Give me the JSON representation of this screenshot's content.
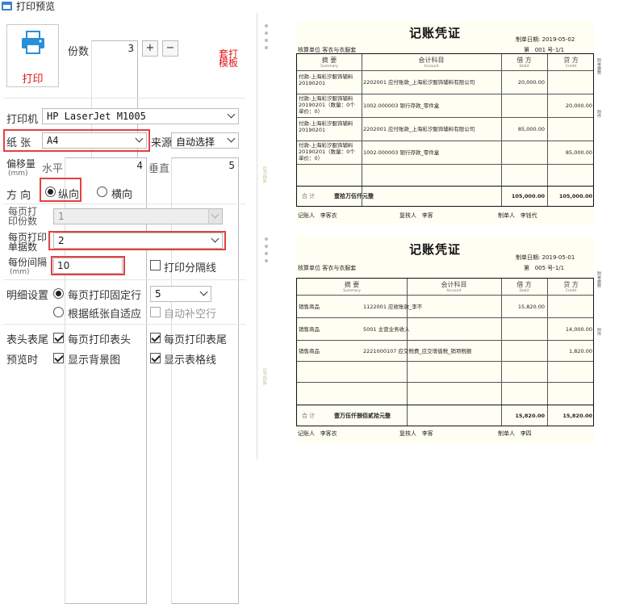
{
  "window": {
    "title": "打印预览"
  },
  "print_button": {
    "label": "打印"
  },
  "copies": {
    "label": "份数",
    "value": "3",
    "plus": "+",
    "minus": "−"
  },
  "template_link": "套打模板",
  "printer": {
    "label": "打印机",
    "value": "HP LaserJet M1005"
  },
  "paper": {
    "label": "纸  张",
    "value": "A4",
    "source_label": "来源",
    "source_value": "自动选择"
  },
  "offset": {
    "label": "偏移量",
    "unit": "(mm)",
    "horizontal_label": "水平",
    "horizontal_value": "4",
    "vertical_label": "垂直",
    "vertical_value": "5"
  },
  "orientation": {
    "label": "方  向",
    "portrait": "纵向",
    "landscape": "横向",
    "selected": "portrait"
  },
  "copies_per_page": {
    "label": "每页打印份数",
    "value": "1"
  },
  "docs_per_page": {
    "label": "每页打印单据数",
    "value": "2"
  },
  "copy_interval": {
    "label": "每份间隔",
    "unit": "(mm)",
    "value": "10",
    "print_separator": "打印分隔线"
  },
  "detail": {
    "label": "明细设置",
    "fixed_rows": "每页打印固定行",
    "fixed_rows_value": "5",
    "adaptive": "根据纸张自适应",
    "auto_fill": "自动补空行"
  },
  "header_footer": {
    "label": "表头表尾",
    "print_header": "每页打印表头",
    "print_footer": "每页打印表尾"
  },
  "preview": {
    "label": "预览时",
    "show_bg": "显示背景图",
    "show_grid": "显示表格线"
  },
  "vouchers": [
    {
      "title": "记账凭证",
      "date_label": "制单日期:",
      "date": "2019-05-02",
      "unit_label": "核算单位",
      "unit": "客衣与衣服套",
      "no_label": "第",
      "no": "001",
      "no_suffix": "号-1/1",
      "headers": {
        "summary": "摘 要",
        "summary_en": "Summary",
        "account": "会计科目",
        "account_en": "Account",
        "debit": "借 方",
        "debit_en": "Debit",
        "credit": "贷 方",
        "credit_en": "Credit"
      },
      "rows": [
        {
          "summary": "付款-上海彩汐服饰辅料 20190201",
          "account": "2202001 应付账款_上海彩汐服饰辅料有限公司",
          "debit": "20,000.00",
          "credit": ""
        },
        {
          "summary": "付款-上海彩汐服饰辅料 20190201（数量：0个 单价：0）",
          "account": "1002.000003 银行存款_零件盒",
          "debit": "",
          "credit": "20,000.00"
        },
        {
          "summary": "付款-上海彩汐服饰辅料 20190201",
          "account": "2202001 应付账款_上海彩汐服饰辅料有限公司",
          "debit": "85,000.00",
          "credit": ""
        },
        {
          "summary": "付款-上海彩汐服饰辅料 20190201（数量：0个 单价：0）",
          "account": "1002.000003 银行存款_零件盒",
          "debit": "",
          "credit": "85,000.00"
        }
      ],
      "total_label": "合 计",
      "total_words": "壹拾万伍仟元整",
      "total_debit": "105,000.00",
      "total_credit": "105,000.00",
      "bookkeeper_label": "记账人",
      "bookkeeper": "李客衣",
      "reviewer_label": "复核人",
      "reviewer": "李客",
      "preparer_label": "制单人",
      "preparer": "李钱代",
      "side_labels": [
        "附单据数",
        "附件"
      ]
    },
    {
      "title": "记账凭证",
      "date_label": "制单日期:",
      "date": "2019-05-01",
      "unit_label": "核算单位",
      "unit": "客衣与衣服套",
      "no_label": "第",
      "no": "005",
      "no_suffix": "号-1/1",
      "headers": {
        "summary": "摘 要",
        "summary_en": "Summary",
        "account": "会计科目",
        "account_en": "Account",
        "debit": "借 方",
        "debit_en": "Debit",
        "credit": "贷 方",
        "credit_en": "Credit"
      },
      "rows": [
        {
          "summary": "销售商品",
          "account": "1122001 应收账款_李不",
          "debit": "15,820.00",
          "credit": ""
        },
        {
          "summary": "销售商品",
          "account": "5001 主营业务收入",
          "debit": "",
          "credit": "14,000.00"
        },
        {
          "summary": "销售商品",
          "account": "2221000107 应交税费_应交增值税_销项税额",
          "debit": "",
          "credit": "1,820.00"
        },
        {
          "summary": "",
          "account": "",
          "debit": "",
          "credit": ""
        },
        {
          "summary": "",
          "account": "",
          "debit": "",
          "credit": ""
        }
      ],
      "total_label": "合 计",
      "total_words": "壹万伍仟捌佰贰拾元整",
      "total_debit": "15,820.00",
      "total_credit": "15,820.00",
      "bookkeeper_label": "记账人",
      "bookkeeper": "李客衣",
      "reviewer_label": "复核人",
      "reviewer": "李客",
      "preparer_label": "制单人",
      "preparer": "李四",
      "side_labels": [
        "附单据数",
        "附件"
      ]
    }
  ]
}
